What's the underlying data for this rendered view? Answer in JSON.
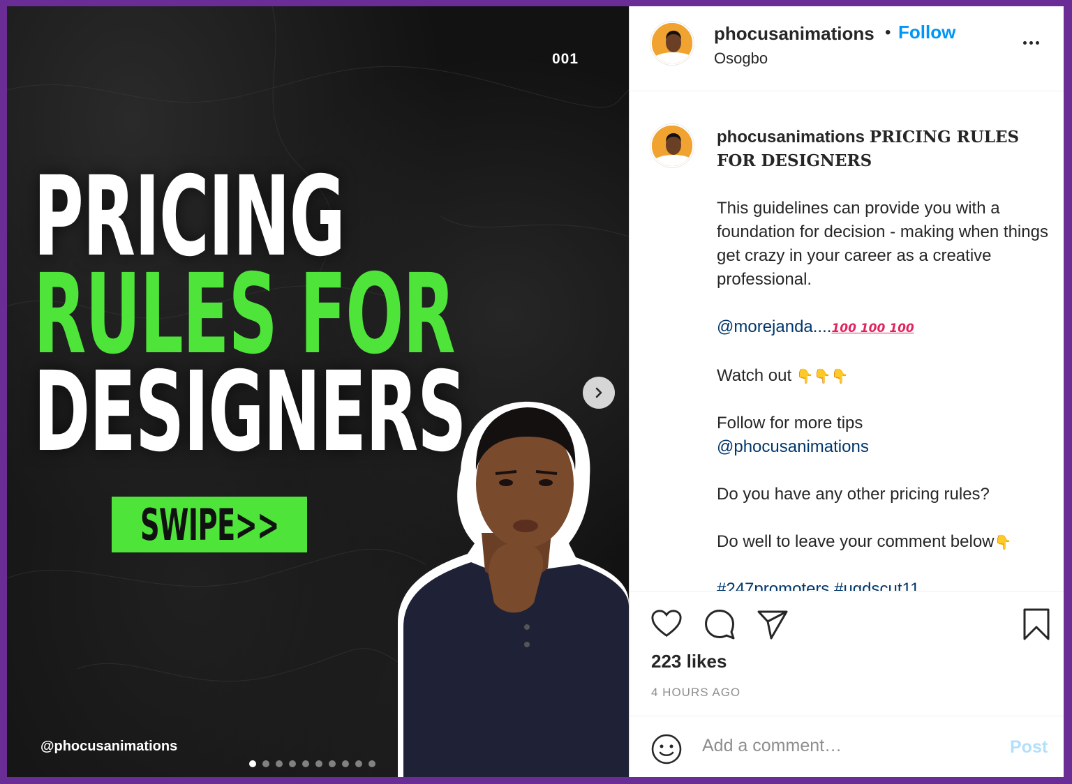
{
  "media": {
    "slide_number": "001",
    "headline_line1": "PRICING",
    "headline_line2": "RULES FOR",
    "headline_line3": "DESIGNERS",
    "swipe_label": "SWIPE>>",
    "handle": "@phocusanimations",
    "slide_count": 10,
    "active_slide": 1,
    "accent_green": "#4ee43a"
  },
  "header": {
    "username": "phocusanimations",
    "separator": "•",
    "follow_label": "Follow",
    "location": "Osogbo"
  },
  "caption": {
    "username": "phocusanimations",
    "title": "PRICING RULES FOR DESIGNERS",
    "para1": "This guidelines can provide you with a foundation for decision - making when things get crazy in your career as a creative professional.",
    "mention1": "@morejanda....",
    "hundreds": "100 100 100",
    "watch_out": "Watch out",
    "pointing": "👇👇👇",
    "follow_text": "Follow for more tips",
    "mention2": "@phocusanimations",
    "question": "Do you have any other pricing rules?",
    "comment_cta": "Do well to leave your comment below",
    "pointing_single": "👇",
    "hashtags": "#247promoters #ugdscut11"
  },
  "actions": {
    "likes": "223 likes",
    "time": "4 HOURS AGO"
  },
  "comment": {
    "placeholder": "Add a comment…",
    "post_label": "Post"
  },
  "icons": [
    "heart-icon",
    "comment-icon",
    "share-icon",
    "bookmark-icon",
    "emoji-icon",
    "chevron-right-icon",
    "more-icon"
  ]
}
